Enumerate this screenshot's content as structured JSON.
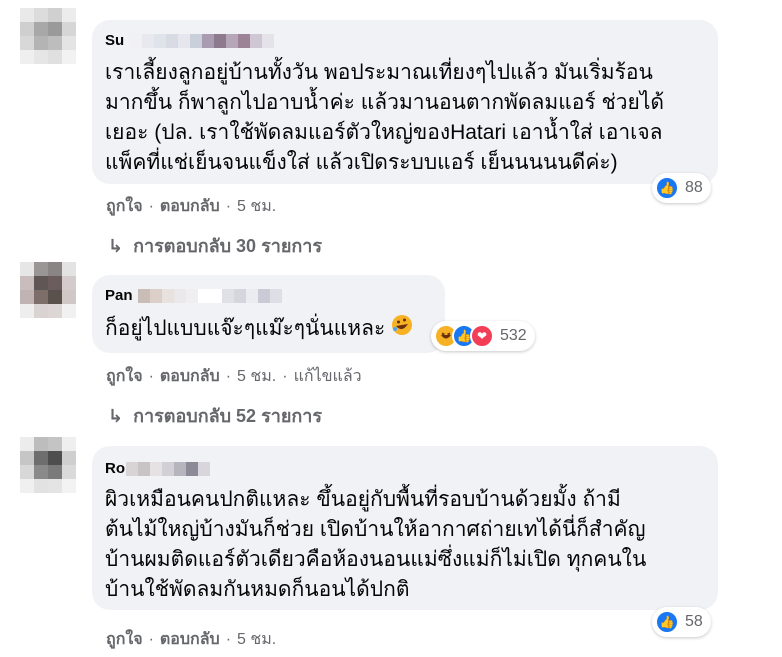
{
  "colors": {
    "bubble": "#f0f2f5",
    "meta": "#65676b",
    "like": "#1877f2",
    "haha": "#f7b125",
    "love": "#f33e58"
  },
  "comments": [
    {
      "author": "Su",
      "text_lines": [
        "เราเลี้ยงลูกอยู่บ้านทั้งวัน พอประมาณเที่ยงๆไปแล้ว มันเริ่มร้อน",
        "มากขึ้น ก็พาลูกไปอาบน้ำค่ะ แล้วมานอนตากพัดลมแอร์ ช่วยได้",
        "เยอะ (ปล. เราใช้พัดลมแอร์ตัวใหญ่ของHatari เอาน้ำใส่ เอาเจล",
        "แพ็คที่แช่เย็นจนแข็งใส่ แล้วเปิดระบบแอร์ เย็นนนนนดีค่ะ)"
      ],
      "reaction_icons": [
        "like-icon"
      ],
      "reaction_count": "88",
      "like_label": "ถูกใจ",
      "reply_label": "ตอบกลับ",
      "time": "5 ชม.",
      "edited": "",
      "replies_label": "การตอบกลับ 30 รายการ"
    },
    {
      "author": "Pan",
      "text_lines": [
        "ก็อยู่ไปแบบแจ๊ะๆแม๊ะๆนั่นแหละ"
      ],
      "reaction_icons": [
        "haha-icon",
        "like-icon",
        "love-icon"
      ],
      "reaction_count": "532",
      "like_label": "ถูกใจ",
      "reply_label": "ตอบกลับ",
      "time": "5 ชม.",
      "edited": "แก้ไขแล้ว",
      "replies_label": "การตอบกลับ 52 รายการ"
    },
    {
      "author": "Ro",
      "text_lines": [
        "ผิวเหมือนคนปกติแหละ ขึ้นอยู่กับพื้นที่รอบบ้านด้วยมั้ง ถ้ามี",
        "ต้นไม้ใหญ่บ้างมันก็ช่วย เปิดบ้านให้อากาศถ่ายเทได้นี่ก็สำคัญ",
        "บ้านผมติดแอร์ตัวเดียวคือห้องนอนแม่ซึ่งแม่ก็ไม่เปิด ทุกคนใน",
        "บ้านใช้พัดลมกันหมดก็นอนได้ปกติ"
      ],
      "reaction_icons": [
        "like-icon"
      ],
      "reaction_count": "58",
      "like_label": "ถูกใจ",
      "reply_label": "ตอบกลับ",
      "time": "5 ชม.",
      "edited": "",
      "replies_label": ""
    }
  ]
}
